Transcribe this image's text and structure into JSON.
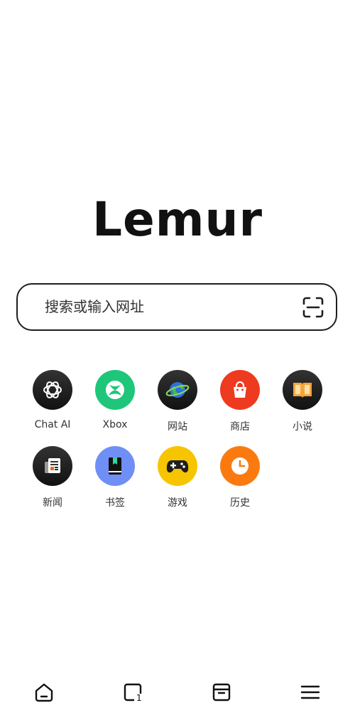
{
  "logo": "Lemur",
  "search": {
    "placeholder": "搜索或输入网址",
    "scan_icon": "scan-icon"
  },
  "shortcuts": [
    {
      "label": "Chat AI",
      "icon": "chatgpt-icon",
      "color": "#1f1f1f"
    },
    {
      "label": "Xbox",
      "icon": "xbox-icon",
      "color": "#1ec67a"
    },
    {
      "label": "网站",
      "icon": "globe-icon",
      "color": "#1f1f1f"
    },
    {
      "label": "商店",
      "icon": "shopping-bag-icon",
      "color": "#ee3a1f"
    },
    {
      "label": "小说",
      "icon": "book-icon",
      "color": "#1f1f1f"
    },
    {
      "label": "新闻",
      "icon": "newspaper-icon",
      "color": "#1f1f1f"
    },
    {
      "label": "书签",
      "icon": "bookmark-book-icon",
      "color": "#6f8ff6"
    },
    {
      "label": "游戏",
      "icon": "gamepad-icon",
      "color": "#f7c500"
    },
    {
      "label": "历史",
      "icon": "clock-icon",
      "color": "#fb7a10"
    }
  ],
  "nav": {
    "home_icon": "home-icon",
    "tabs_icon": "tabs-icon",
    "tab_count": "1",
    "archive_icon": "archive-icon",
    "menu_icon": "menu-icon"
  }
}
